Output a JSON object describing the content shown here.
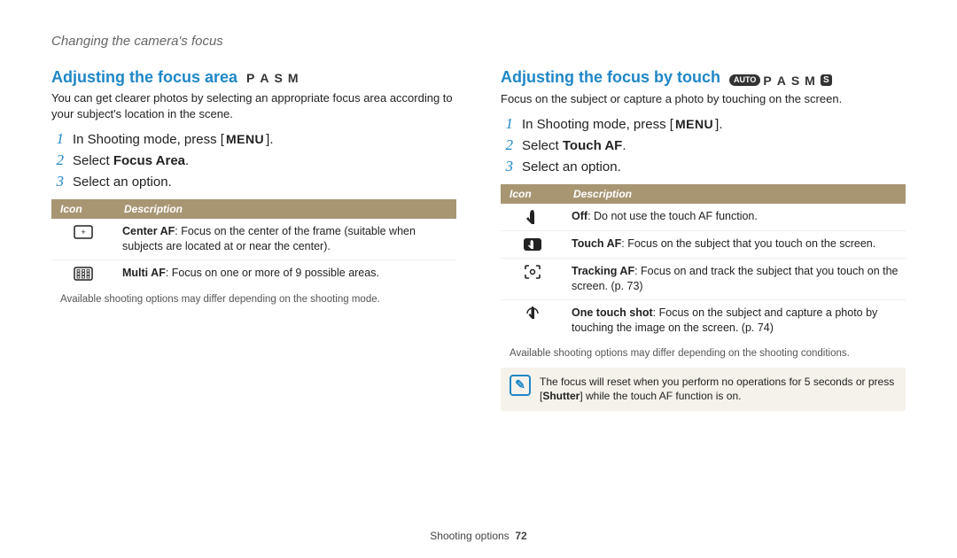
{
  "breadcrumb": "Changing the camera's focus",
  "left": {
    "title": "Adjusting the focus area",
    "modes": [
      "P",
      "A",
      "S",
      "M"
    ],
    "intro": "You can get clearer photos by selecting an appropriate focus area according to your subject's location in the scene.",
    "steps": [
      {
        "num": "1",
        "pre": "In Shooting mode, press [",
        "chip": "MENU",
        "post": "]."
      },
      {
        "num": "2",
        "pre": "Select ",
        "bold": "Focus Area",
        "post": "."
      },
      {
        "num": "3",
        "pre": "Select an option.",
        "bold": "",
        "post": ""
      }
    ],
    "table_headers": {
      "icon": "Icon",
      "desc": "Description"
    },
    "rows": [
      {
        "icon": "center-af-icon",
        "bold": "Center AF",
        "text": ": Focus on the center of the frame (suitable when subjects are located at or near the center)."
      },
      {
        "icon": "multi-af-icon",
        "bold": "Multi AF",
        "text": ": Focus on one or more of 9 possible areas."
      }
    ],
    "footnote": "Available shooting options may differ depending on the shooting mode."
  },
  "right": {
    "title": "Adjusting the focus by touch",
    "mode_auto": "AUTO",
    "modes": [
      "P",
      "A",
      "S",
      "M"
    ],
    "mode_s_round": "S",
    "intro": "Focus on the subject or capture a photo by touching on the screen.",
    "steps": [
      {
        "num": "1",
        "pre": "In Shooting mode, press [",
        "chip": "MENU",
        "post": "]."
      },
      {
        "num": "2",
        "pre": "Select ",
        "bold": "Touch AF",
        "post": "."
      },
      {
        "num": "3",
        "pre": "Select an option.",
        "bold": "",
        "post": ""
      }
    ],
    "table_headers": {
      "icon": "Icon",
      "desc": "Description"
    },
    "rows": [
      {
        "icon": "off-icon",
        "bold": "Off",
        "text": ": Do not use the touch AF function."
      },
      {
        "icon": "touch-af-icon",
        "bold": "Touch AF",
        "text": ": Focus on the subject that you touch on the screen."
      },
      {
        "icon": "tracking-af-icon",
        "bold": "Tracking AF",
        "text": ": Focus on and track the subject that you touch on the screen. (p. 73)"
      },
      {
        "icon": "one-touch-shot-icon",
        "bold": "One touch shot",
        "text": ": Focus on the subject and capture a photo by touching the image on the screen. (p. 74)"
      }
    ],
    "footnote": "Available shooting options may differ depending on the shooting conditions.",
    "tip_pre": "The focus will reset when you perform no operations for 5 seconds or press [",
    "tip_bold": "Shutter",
    "tip_post": "] while the touch AF function is on."
  },
  "footer": {
    "section": "Shooting options",
    "page": "72"
  }
}
